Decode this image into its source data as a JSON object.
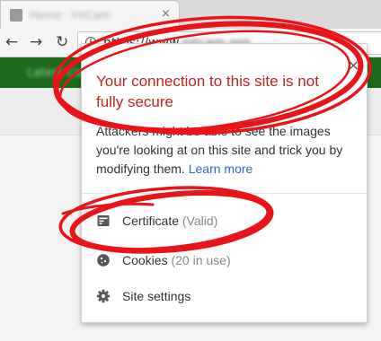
{
  "browser": {
    "tab": {
      "title": "Home · IntCam",
      "close_glyph": "×"
    },
    "nav": {
      "back_glyph": "←",
      "forward_glyph": "→",
      "reload_glyph": "↻"
    },
    "address": {
      "scheme": "https://www.",
      "domain": "intcam.org",
      "info_glyph": "i"
    }
  },
  "site": {
    "header_text": "Latest Cams"
  },
  "popup": {
    "close_glyph": "×",
    "title": "Your connection to this site is not fully secure",
    "description": "Attackers might be able to see the images you're looking at on this site and trick you by modifying them.",
    "learn_more": "Learn more",
    "items": [
      {
        "label": "Certificate",
        "sublabel": "(Valid)",
        "icon": "certificate-icon"
      },
      {
        "label": "Cookies",
        "sublabel": "(20 in use)",
        "icon": "cookie-icon"
      },
      {
        "label": "Site settings",
        "sublabel": "",
        "icon": "gear-icon"
      }
    ]
  },
  "colors": {
    "warning_red": "#c5221f",
    "link_blue": "#3367d6",
    "annotation_red": "#e8141a",
    "site_green": "#1b6b1b"
  }
}
